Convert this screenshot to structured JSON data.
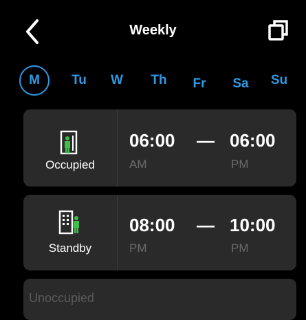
{
  "header": {
    "title": "Weekly",
    "back_icon": "chevron-left-icon",
    "copy_icon": "copy-icon"
  },
  "days": [
    {
      "label": "M",
      "selected": true
    },
    {
      "label": "Tu",
      "selected": false
    },
    {
      "label": "W",
      "selected": false
    },
    {
      "label": "Th",
      "selected": false
    },
    {
      "label": "Fr",
      "selected": false
    },
    {
      "label": "Sa",
      "selected": false
    },
    {
      "label": "Su",
      "selected": false
    }
  ],
  "schedule": [
    {
      "mode": "Occupied",
      "icon": "occupied-building-person-icon",
      "start_time": "06:00",
      "start_ampm": "AM",
      "separator": "—",
      "end_time": "06:00",
      "end_ampm": "PM"
    },
    {
      "mode": "Standby",
      "icon": "standby-building-person-icon",
      "start_time": "08:00",
      "start_ampm": "PM",
      "separator": "—",
      "end_time": "10:00",
      "end_ampm": "PM"
    },
    {
      "mode": "Unoccupied"
    }
  ],
  "colors": {
    "accent": "#2f9ae6",
    "background": "#000000",
    "card": "#2a2a2a",
    "muted_text": "#6a6a6a",
    "icon_green": "#3fbf49"
  }
}
